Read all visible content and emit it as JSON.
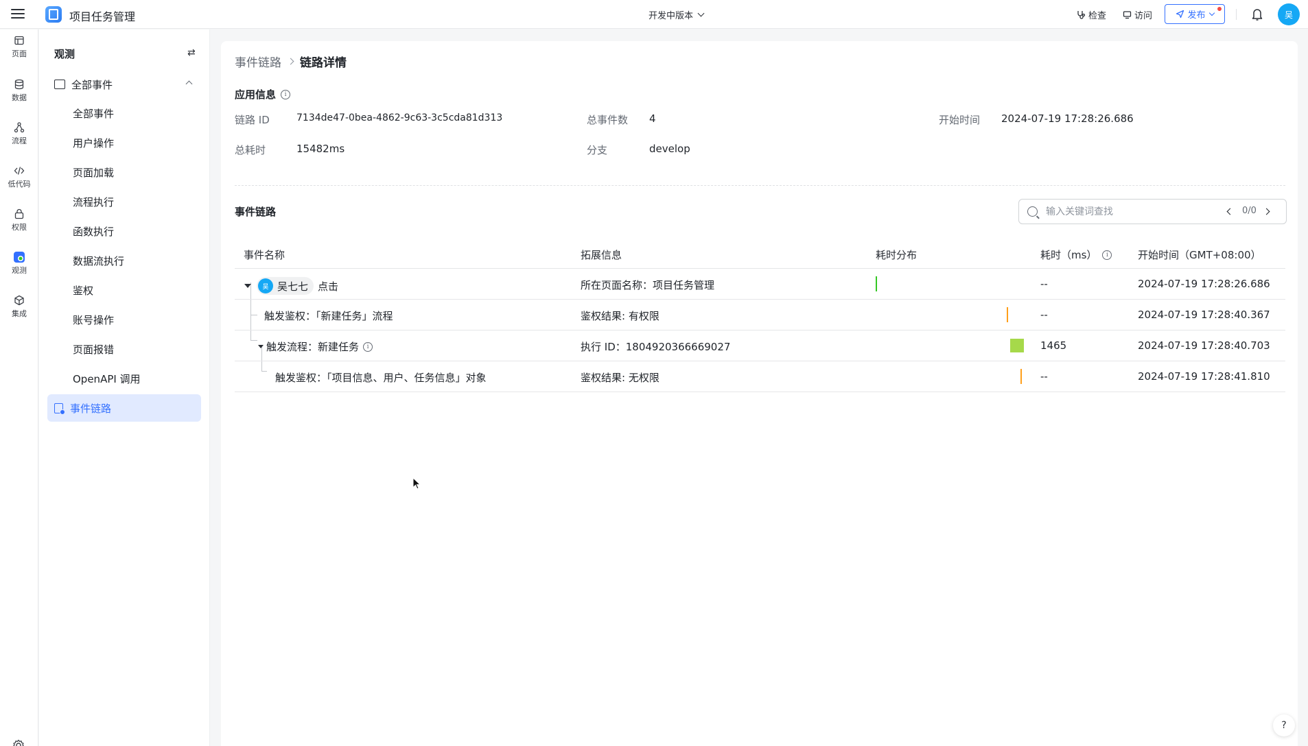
{
  "topbar": {
    "app_title": "项目任务管理",
    "version_label": "开发中版本",
    "check_label": "检查",
    "visit_label": "访问",
    "publish_label": "发布",
    "avatar_text": "吴"
  },
  "rail": {
    "items": [
      {
        "label": "页面",
        "icon": "page-icon"
      },
      {
        "label": "数据",
        "icon": "database-icon"
      },
      {
        "label": "流程",
        "icon": "flow-icon"
      },
      {
        "label": "低代码",
        "icon": "code-icon"
      },
      {
        "label": "权限",
        "icon": "lock-icon"
      },
      {
        "label": "观测",
        "icon": "observe-icon",
        "active": true
      },
      {
        "label": "集成",
        "icon": "cube-icon"
      }
    ]
  },
  "sidebar": {
    "title": "观测",
    "group_label": "全部事件",
    "items": [
      "全部事件",
      "用户操作",
      "页面加载",
      "流程执行",
      "函数执行",
      "数据流执行",
      "鉴权",
      "账号操作",
      "页面报错",
      "OpenAPI 调用"
    ],
    "active_item": "事件链路"
  },
  "breadcrumb": {
    "parent": "事件链路",
    "current": "链路详情"
  },
  "app_info": {
    "title": "应用信息",
    "trace_id_label": "链路 ID",
    "trace_id": "7134de47-0bea-4862-9c63-3c5cda81d313",
    "event_count_label": "总事件数",
    "event_count": "4",
    "start_time_label": "开始时间",
    "start_time": "2024-07-19 17:28:26.686",
    "duration_label": "总耗时",
    "duration": "15482ms",
    "branch_label": "分支",
    "branch": "develop"
  },
  "event_chain": {
    "title": "事件链路",
    "search_placeholder": "输入关键词查找",
    "match_count": "0/0",
    "columns": [
      "事件名称",
      "拓展信息",
      "耗时分布",
      "耗时（ms）",
      "开始时间（GMT+08:00）"
    ],
    "rows": [
      {
        "user": "吴七七",
        "user_avatar": "吴",
        "name": "点击",
        "ext": "所在页面名称：项目任务管理",
        "duration": "--",
        "start": "2024-07-19 17:28:26.686",
        "bar_color": "#34c724",
        "bar_start": 0.0,
        "bar_width": 0.0
      },
      {
        "name": "触发鉴权：「新建任务」流程",
        "ext": "鉴权结果: 有权限",
        "duration": "--",
        "start": "2024-07-19 17:28:40.367",
        "bar_color": "#ff9f1a",
        "bar_start": 0.8837,
        "bar_width": 0.0
      },
      {
        "name": "触发流程：新建任务",
        "ext": "执行 ID：1804920366669027",
        "duration": "1465",
        "start": "2024-07-19 17:28:40.703",
        "bar_color": "#a6d94a",
        "bar_start": 0.9054,
        "bar_width": 0.0946
      },
      {
        "name": "触发鉴权：「项目信息、用户、任务信息」对象",
        "ext": "鉴权结果: 无权限",
        "duration": "--",
        "start": "2024-07-19 17:28:41.810",
        "bar_color": "#ff9f1a",
        "bar_start": 0.9769,
        "bar_width": 0.0
      }
    ]
  }
}
